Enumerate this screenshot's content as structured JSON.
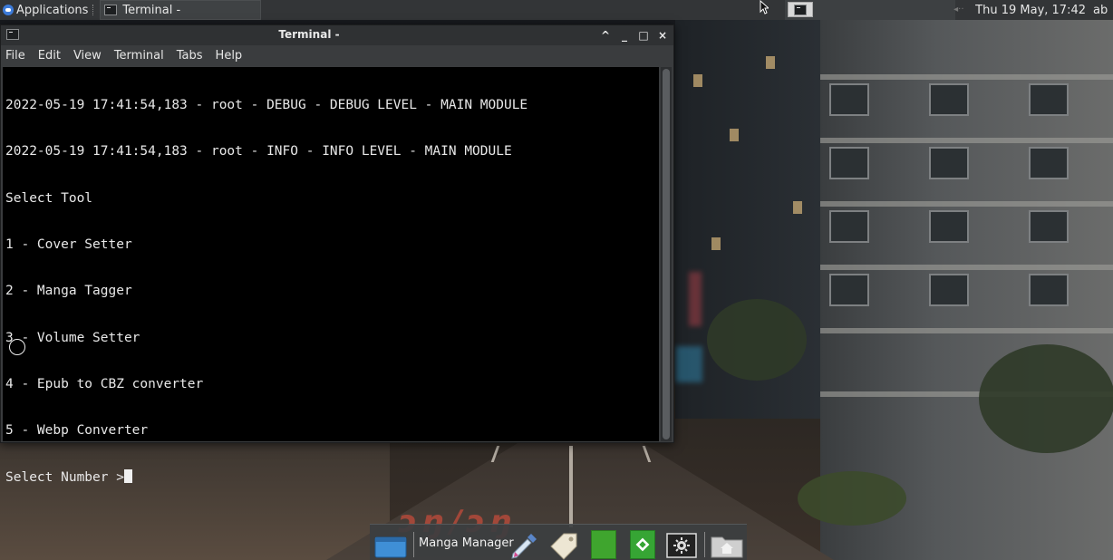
{
  "top_panel": {
    "applications_label": "Applications",
    "task_title": "Terminal -",
    "clock": "Thu 19 May, 17:42",
    "user": "ab"
  },
  "window": {
    "title": "Terminal -",
    "controls": [
      "^",
      "_",
      "□",
      "×"
    ],
    "menu": [
      "File",
      "Edit",
      "View",
      "Terminal",
      "Tabs",
      "Help"
    ]
  },
  "terminal": {
    "lines": [
      "2022-05-19 17:41:54,183 - root - DEBUG - DEBUG LEVEL - MAIN MODULE",
      "2022-05-19 17:41:54,183 - root - INFO - INFO LEVEL - MAIN MODULE",
      "Select Tool",
      "1 - Cover Setter",
      "2 - Manga Tagger",
      "3 - Volume Setter",
      "4 - Epub to CBZ converter",
      "5 - Webp Converter"
    ],
    "prompt": "Select Number >"
  },
  "dock": {
    "label": "Manga Manager"
  },
  "colors": {
    "panel_bg": "#333537",
    "terminal_bg": "#000000",
    "terminal_fg": "#e8e8e8",
    "window_chrome": "#3a3c3e"
  }
}
